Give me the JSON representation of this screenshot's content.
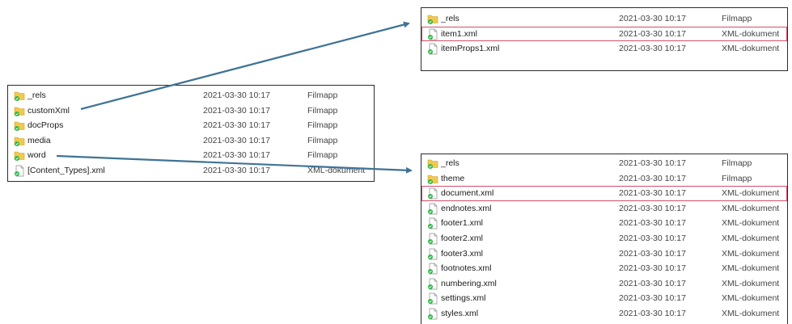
{
  "panels": {
    "left": {
      "rows": [
        {
          "name": "_rels",
          "date": "2021-03-30 10:17",
          "type": "Filmapp",
          "icon": "folder-icon"
        },
        {
          "name": "customXml",
          "date": "2021-03-30 10:17",
          "type": "Filmapp",
          "icon": "folder-icon"
        },
        {
          "name": "docProps",
          "date": "2021-03-30 10:17",
          "type": "Filmapp",
          "icon": "folder-icon"
        },
        {
          "name": "media",
          "date": "2021-03-30 10:17",
          "type": "Filmapp",
          "icon": "folder-icon"
        },
        {
          "name": "word",
          "date": "2021-03-30 10:17",
          "type": "Filmapp",
          "icon": "folder-icon"
        },
        {
          "name": "[Content_Types].xml",
          "date": "2021-03-30 10:17",
          "type": "XML-dokument",
          "icon": "xml-file-icon"
        }
      ]
    },
    "top": {
      "rows": [
        {
          "name": "_rels",
          "date": "2021-03-30 10:17",
          "type": "Filmapp",
          "icon": "folder-icon"
        },
        {
          "name": "item1.xml",
          "date": "2021-03-30 10:17",
          "type": "XML-dokument",
          "icon": "xml-file-icon",
          "highlight": true
        },
        {
          "name": "itemProps1.xml",
          "date": "2021-03-30 10:17",
          "type": "XML-dokument",
          "icon": "xml-file-icon"
        }
      ]
    },
    "bottom": {
      "rows": [
        {
          "name": "_rels",
          "date": "2021-03-30 10:17",
          "type": "Filmapp",
          "icon": "folder-icon"
        },
        {
          "name": "theme",
          "date": "2021-03-30 10:17",
          "type": "Filmapp",
          "icon": "folder-icon"
        },
        {
          "name": "document.xml",
          "date": "2021-03-30 10:17",
          "type": "XML-dokument",
          "icon": "xml-file-icon",
          "highlight": true
        },
        {
          "name": "endnotes.xml",
          "date": "2021-03-30 10:17",
          "type": "XML-dokument",
          "icon": "xml-file-icon"
        },
        {
          "name": "footer1.xml",
          "date": "2021-03-30 10:17",
          "type": "XML-dokument",
          "icon": "xml-file-icon"
        },
        {
          "name": "footer2.xml",
          "date": "2021-03-30 10:17",
          "type": "XML-dokument",
          "icon": "xml-file-icon"
        },
        {
          "name": "footer3.xml",
          "date": "2021-03-30 10:17",
          "type": "XML-dokument",
          "icon": "xml-file-icon"
        },
        {
          "name": "footnotes.xml",
          "date": "2021-03-30 10:17",
          "type": "XML-dokument",
          "icon": "xml-file-icon"
        },
        {
          "name": "numbering.xml",
          "date": "2021-03-30 10:17",
          "type": "XML-dokument",
          "icon": "xml-file-icon"
        },
        {
          "name": "settings.xml",
          "date": "2021-03-30 10:17",
          "type": "XML-dokument",
          "icon": "xml-file-icon"
        },
        {
          "name": "styles.xml",
          "date": "2021-03-30 10:17",
          "type": "XML-dokument",
          "icon": "xml-file-icon"
        }
      ]
    }
  },
  "colors": {
    "arrow": "#3f7396",
    "highlight_border": "#d0506a",
    "folder": "#f2c94c",
    "sync_badge": "#2fb84a"
  }
}
